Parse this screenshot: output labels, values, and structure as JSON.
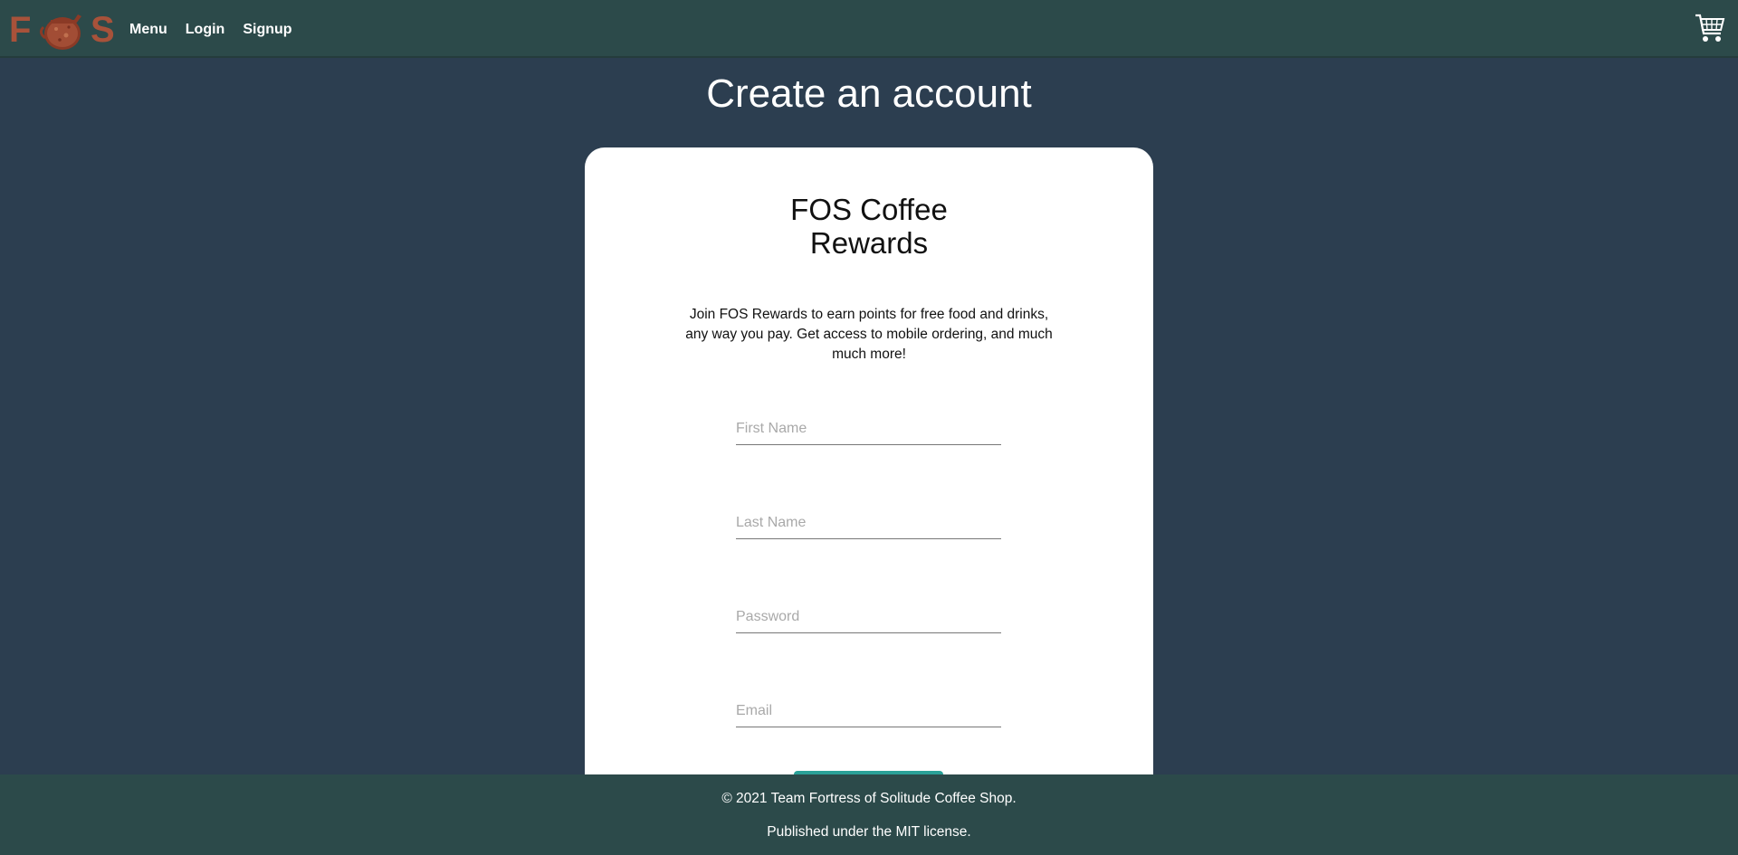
{
  "nav": {
    "logo_letters": [
      "F",
      "S"
    ],
    "links": [
      "Menu",
      "Login",
      "Signup"
    ],
    "cart_icon": "shopping-cart-icon"
  },
  "page": {
    "title": "Create an account"
  },
  "card": {
    "title_line1": "FOS Coffee",
    "title_line2": "Rewards",
    "description": "Join FOS Rewards to earn points for free food and drinks, any way you pay. Get access to mobile ordering, and much much more!",
    "fields": {
      "first_name": "First Name",
      "last_name": "Last Name",
      "password": "Password",
      "email": "Email"
    }
  },
  "footer": {
    "copyright": "© 2021 Team Fortress of Solitude Coffee Shop.",
    "license": "Published under the MIT license."
  },
  "colors": {
    "background": "#2c3e50",
    "navbar": "#2c4a4a",
    "logo": "#a8523a",
    "button": "#2aa198"
  }
}
